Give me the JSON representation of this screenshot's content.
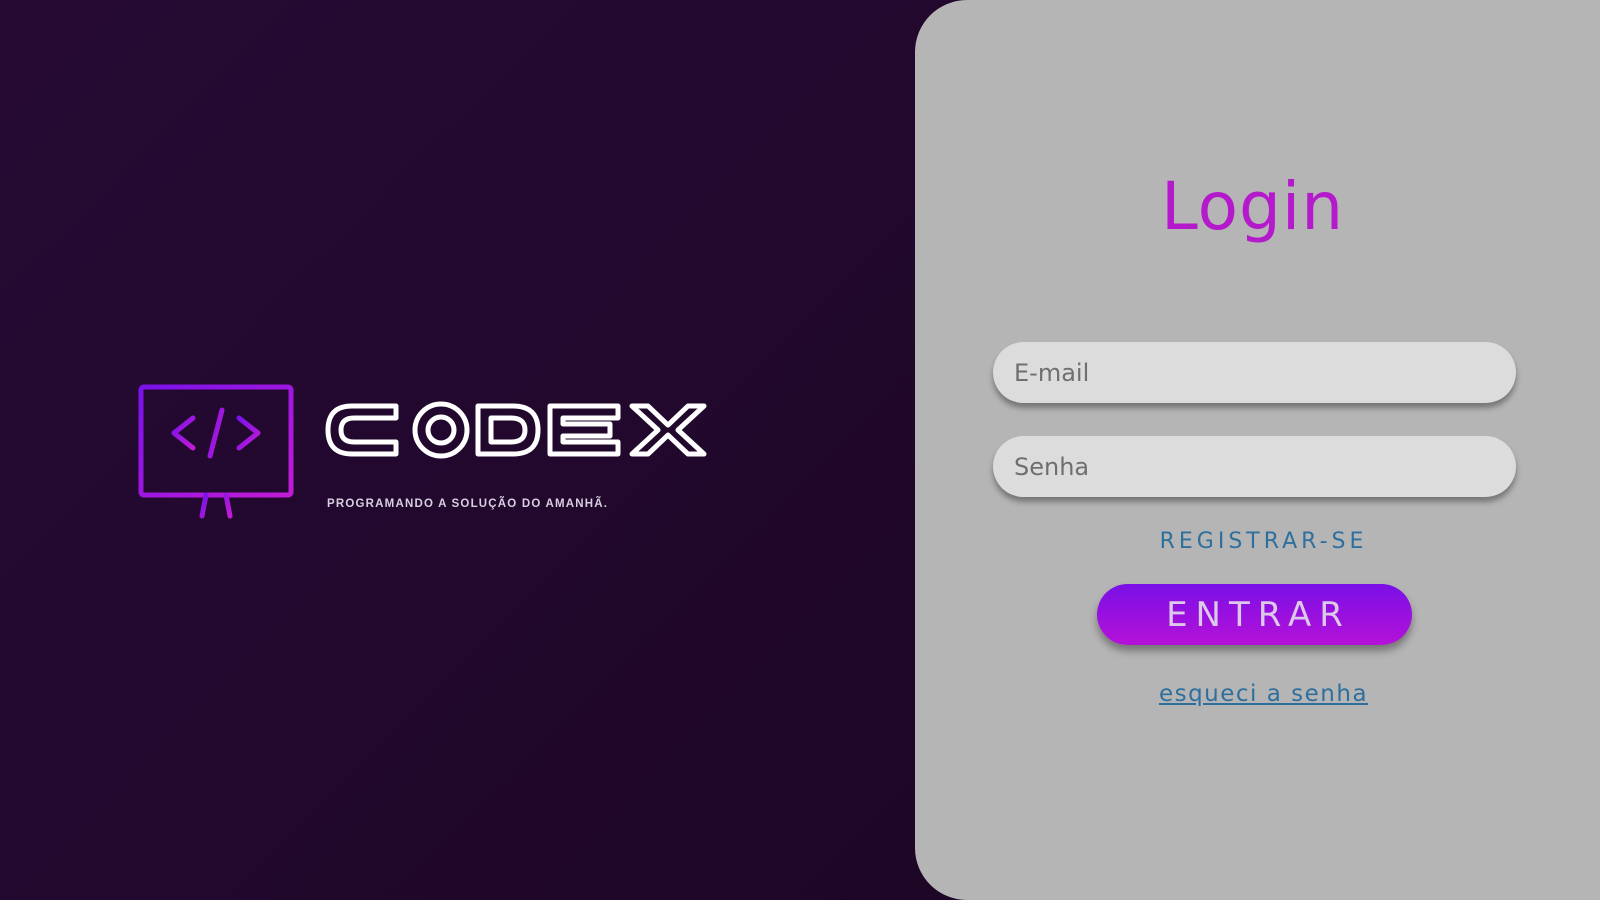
{
  "brand": {
    "logo_text": "CODEX",
    "tagline": "PROGRAMANDO A SOLUÇÃO DO AMANHÃ.",
    "icon": "monitor-code-icon",
    "accent_colors": [
      "#7a12ea",
      "#c21bd6"
    ]
  },
  "login": {
    "title": "Login",
    "email_placeholder": "E-mail",
    "password_placeholder": "Senha",
    "register_label": "REGISTRAR-SE",
    "enter_label": "ENTRAR",
    "forgot_label": "esqueci a senha"
  },
  "colors": {
    "background": "#230930",
    "panel": "#b5b5b5",
    "title": "#b519cc",
    "link": "#2e6f9e",
    "button_gradient": [
      "#7a10e6",
      "#b511d8"
    ]
  }
}
